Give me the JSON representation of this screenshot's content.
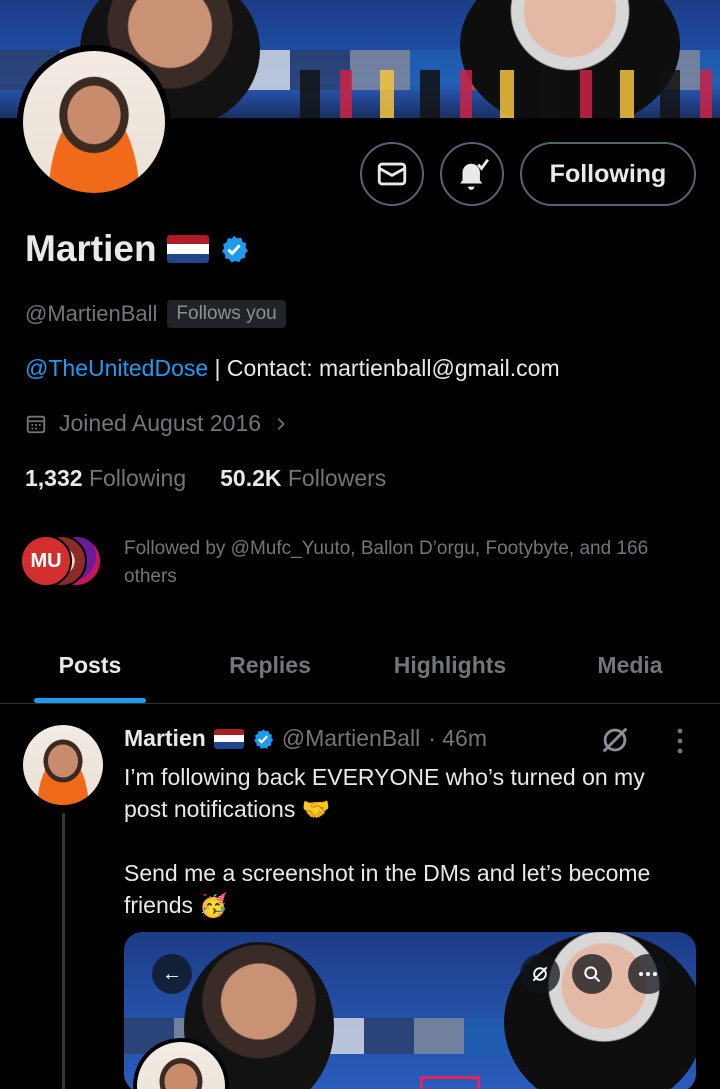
{
  "profile": {
    "name": "Martien",
    "handle": "@MartienBall",
    "follows_you": "Follows you",
    "bio_link": "@TheUnitedDose",
    "bio_rest": " | Contact: martienball@gmail.com",
    "joined": "Joined August 2016",
    "following_count": "1,332",
    "following_label": "Following",
    "followers_count": "50.2K",
    "followers_label": "Followers",
    "followed_by": "Followed by @Mufc_Yuuto, Ballon D’orgu, Footybyte, and 166 others",
    "mini_avatar_text": "MU"
  },
  "actions": {
    "message_icon": "envelope-icon",
    "notify_icon": "bell-check-icon",
    "follow_label": "Following"
  },
  "tabs": [
    {
      "label": "Posts",
      "active": true
    },
    {
      "label": "Replies",
      "active": false
    },
    {
      "label": "Highlights",
      "active": false
    },
    {
      "label": "Media",
      "active": false
    }
  ],
  "post": {
    "name": "Martien",
    "handle": "@MartienBall",
    "time": "· 46m",
    "text": "I’m following back EVERYONE who’s turned on my post notifications 🤝\n\nSend me a screenshot in the DMs and let’s become friends 🥳"
  },
  "colors": {
    "accent": "#1d9bf0",
    "background": "#000000",
    "muted": "#71767b",
    "flag_red": "#ae1c28",
    "flag_white": "#ffffff",
    "flag_blue": "#21468b"
  }
}
